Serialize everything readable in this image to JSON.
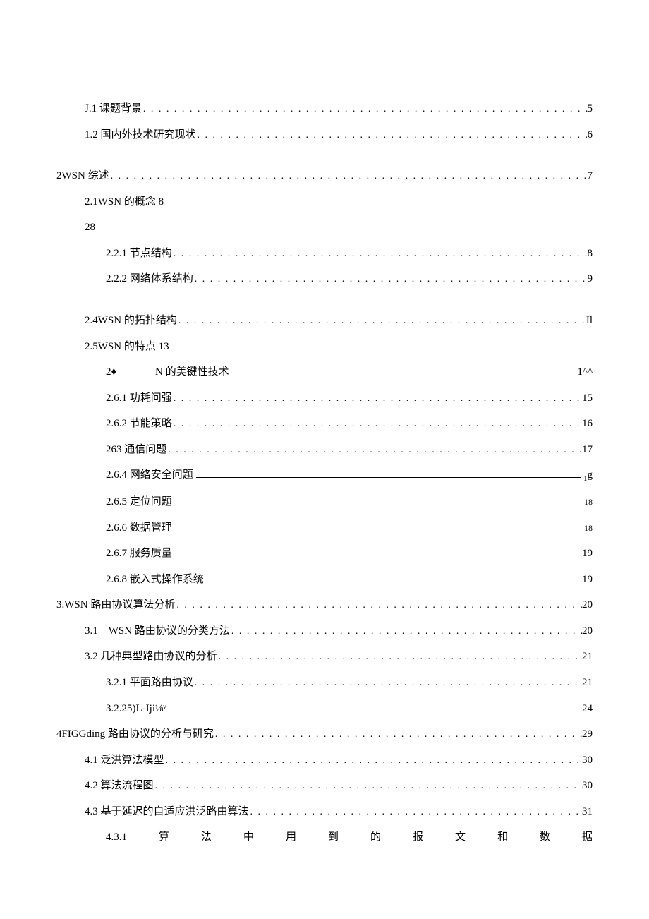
{
  "toc": [
    {
      "indent": 1,
      "label": "J.1 课题背景",
      "leader": "dots",
      "page": "5"
    },
    {
      "indent": 1,
      "label": "1.2 国内外技术研究现状",
      "leader": "dots",
      "page": "6"
    },
    {
      "indent": -1,
      "type": "gap"
    },
    {
      "indent": 0,
      "label": "2WSN 综述",
      "leader": "dots",
      "page": "7"
    },
    {
      "indent": 1,
      "label": "2.1WSN 的概念 8",
      "leader": "none",
      "page": ""
    },
    {
      "indent": 1,
      "label": "28",
      "leader": "none",
      "page": ""
    },
    {
      "indent": 2,
      "label": "2.2.1 节点结构",
      "leader": "dots",
      "page": "8"
    },
    {
      "indent": 2,
      "label": "2.2.2 网络体系结构",
      "leader": "dots",
      "page": "9"
    },
    {
      "indent": -1,
      "type": "gap"
    },
    {
      "indent": 1,
      "label": "2.4WSN 的拓扑结构",
      "leader": "dots",
      "page": "Il"
    },
    {
      "indent": 1,
      "label": "2.5WSN 的特点 13",
      "leader": "none",
      "page": ""
    },
    {
      "indent": 2,
      "label_left": "2♦",
      "label_mid": "N 的美键性技术",
      "leader": "space",
      "page": "1^^",
      "type": "split"
    },
    {
      "indent": 2,
      "label": "2.6.1 功耗问强",
      "leader": "dots",
      "page": "15"
    },
    {
      "indent": 2,
      "label": "2.6.2 节能策略",
      "leader": "dots",
      "page": "16"
    },
    {
      "indent": 2,
      "label": "263 通信问题",
      "leader": "dots",
      "page": "17"
    },
    {
      "indent": 2,
      "label": "2.6.4 网络安全问题",
      "leader": "underline",
      "page_sub": "1",
      "page": "g"
    },
    {
      "indent": 2,
      "label": "2.6.5 定位问题",
      "leader": "space",
      "page": "18",
      "page_small": true
    },
    {
      "indent": 2,
      "label": "2.6.6 数据管理",
      "leader": "space",
      "page": "18",
      "page_small": true
    },
    {
      "indent": 2,
      "label": "2.6.7 服务质量",
      "leader": "space",
      "page": "19"
    },
    {
      "indent": 2,
      "label": "2.6.8 嵌入式操作系统",
      "leader": "space",
      "page": "19"
    },
    {
      "indent": 0,
      "label": "3.WSN 路由协议算法分析",
      "leader": "dots",
      "page": "20"
    },
    {
      "indent": 1,
      "label": "3.1　WSN 路由协议的分类方法",
      "leader": "dots",
      "page": "20"
    },
    {
      "indent": 1,
      "label": "3.2 几种典型路由协议的分析",
      "leader": "dots",
      "page": "21"
    },
    {
      "indent": 2,
      "label": "3.2.1 平面路由协议",
      "leader": "dots",
      "page": "21"
    },
    {
      "indent": 2,
      "label": "3.2.25)L-Iji⅛ᵛ",
      "leader": "space",
      "page": "24"
    },
    {
      "indent": 0,
      "label": "4FIGGding 路由协议的分析与研究",
      "leader": "dots",
      "page": "29"
    },
    {
      "indent": 1,
      "label": "4.1 泛洪算法模型",
      "leader": "dots",
      "page": "30"
    },
    {
      "indent": 1,
      "label": "4.2 算法流程图",
      "leader": "dots",
      "page": "30"
    },
    {
      "indent": 1,
      "label": "4.3 基于延迟的自适应洪泛路由算法",
      "leader": "dots",
      "page": "31"
    },
    {
      "indent": 2,
      "type": "justify",
      "chars": [
        "4.3.1",
        "算",
        "法",
        "中",
        "用",
        "到",
        "的",
        "报",
        "文",
        "和",
        "数",
        "据"
      ]
    }
  ]
}
